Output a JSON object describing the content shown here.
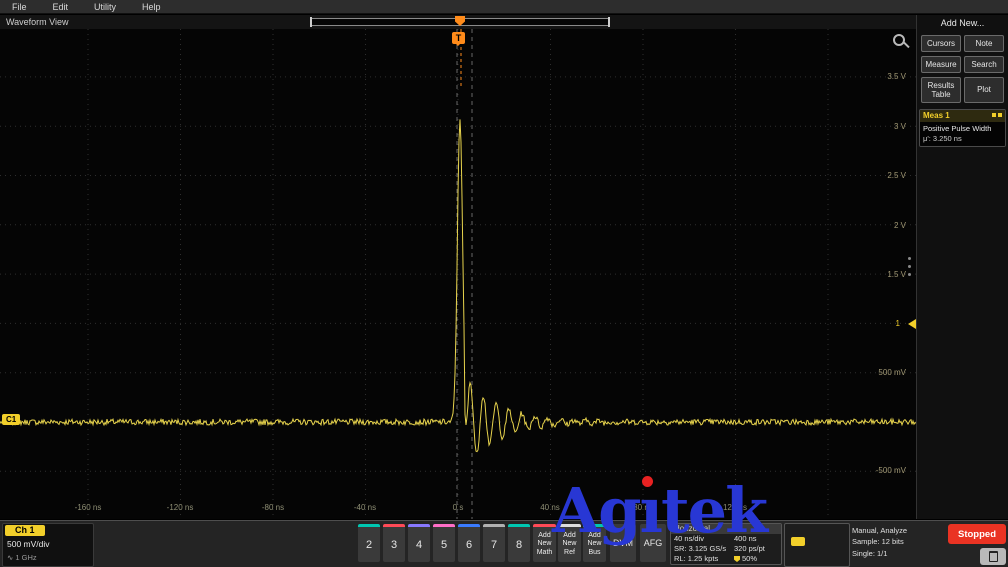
{
  "menubar": {
    "items": [
      "File",
      "Edit",
      "Utility",
      "Help"
    ]
  },
  "view_label": "Waveform View",
  "plot": {
    "y_labels": [
      "3.5 V",
      "3 V",
      "2.5 V",
      "2 V",
      "1.5 V",
      "1",
      "500 mV",
      "-500 mV"
    ],
    "x_labels": [
      "-160 ns",
      "-120 ns",
      "-80 ns",
      "-40 ns",
      "0 s",
      "40 ns",
      "80 ns",
      "120 ns"
    ],
    "trigger_flag": "T",
    "channel_marker": "C1",
    "waveform": {
      "color": "#e8d44d",
      "volts_per_div": 0.5,
      "time_per_div_ns": 40,
      "peak_v": 3.08,
      "ring_amplitude_v": 0.48,
      "noise_vpp": 0.06,
      "trigger_position_pct": 50
    }
  },
  "right_panel": {
    "add_new_label": "Add New...",
    "buttons": [
      "Cursors",
      "Note",
      "Measure",
      "Search",
      "Results Table",
      "Plot"
    ],
    "meas1": {
      "title": "Meas 1",
      "name": "Positive Pulse Width",
      "value": "μ': 3.250 ns"
    }
  },
  "bottom_bar": {
    "ch1": {
      "label": "Ch 1",
      "scale": "500 mV/div",
      "bandwidth": "1 GHz"
    },
    "channel_buttons": [
      {
        "label": "2",
        "color": "#00c7b1"
      },
      {
        "label": "3",
        "color": "#ff4a57"
      },
      {
        "label": "4",
        "color": "#8878ff"
      },
      {
        "label": "5",
        "color": "#ff6ec7"
      },
      {
        "label": "6",
        "color": "#3a7bff"
      },
      {
        "label": "7",
        "color": "#b0b0b0"
      },
      {
        "label": "8",
        "color": "#00c7b1"
      }
    ],
    "add_buttons": [
      {
        "label": "Add New Math",
        "color": "#ff4a57"
      },
      {
        "label": "Add New Ref",
        "color": "#dcdcdc"
      },
      {
        "label": "Add New Bus",
        "color": "#00c7b1"
      }
    ],
    "dvm_label": "DVM",
    "afg_label": "AFG",
    "horizontal": {
      "title": "Horizontal",
      "rows": [
        [
          "40 ns/div",
          "400 ns"
        ],
        [
          "SR: 3.125 GS/s",
          "320 ps/pt"
        ],
        [
          "RL: 1.25 kpts",
          "50%"
        ]
      ]
    },
    "acquisition": {
      "lines": [
        "Manual, Analyze",
        "Sample: 12 bits",
        "Single: 1/1"
      ]
    },
    "run_state": "Stopped"
  },
  "watermark": {
    "part1": "Ag",
    "part2": "ı",
    "part3": "tek",
    "color": "#2837d4",
    "dot_color": "#e82222"
  }
}
